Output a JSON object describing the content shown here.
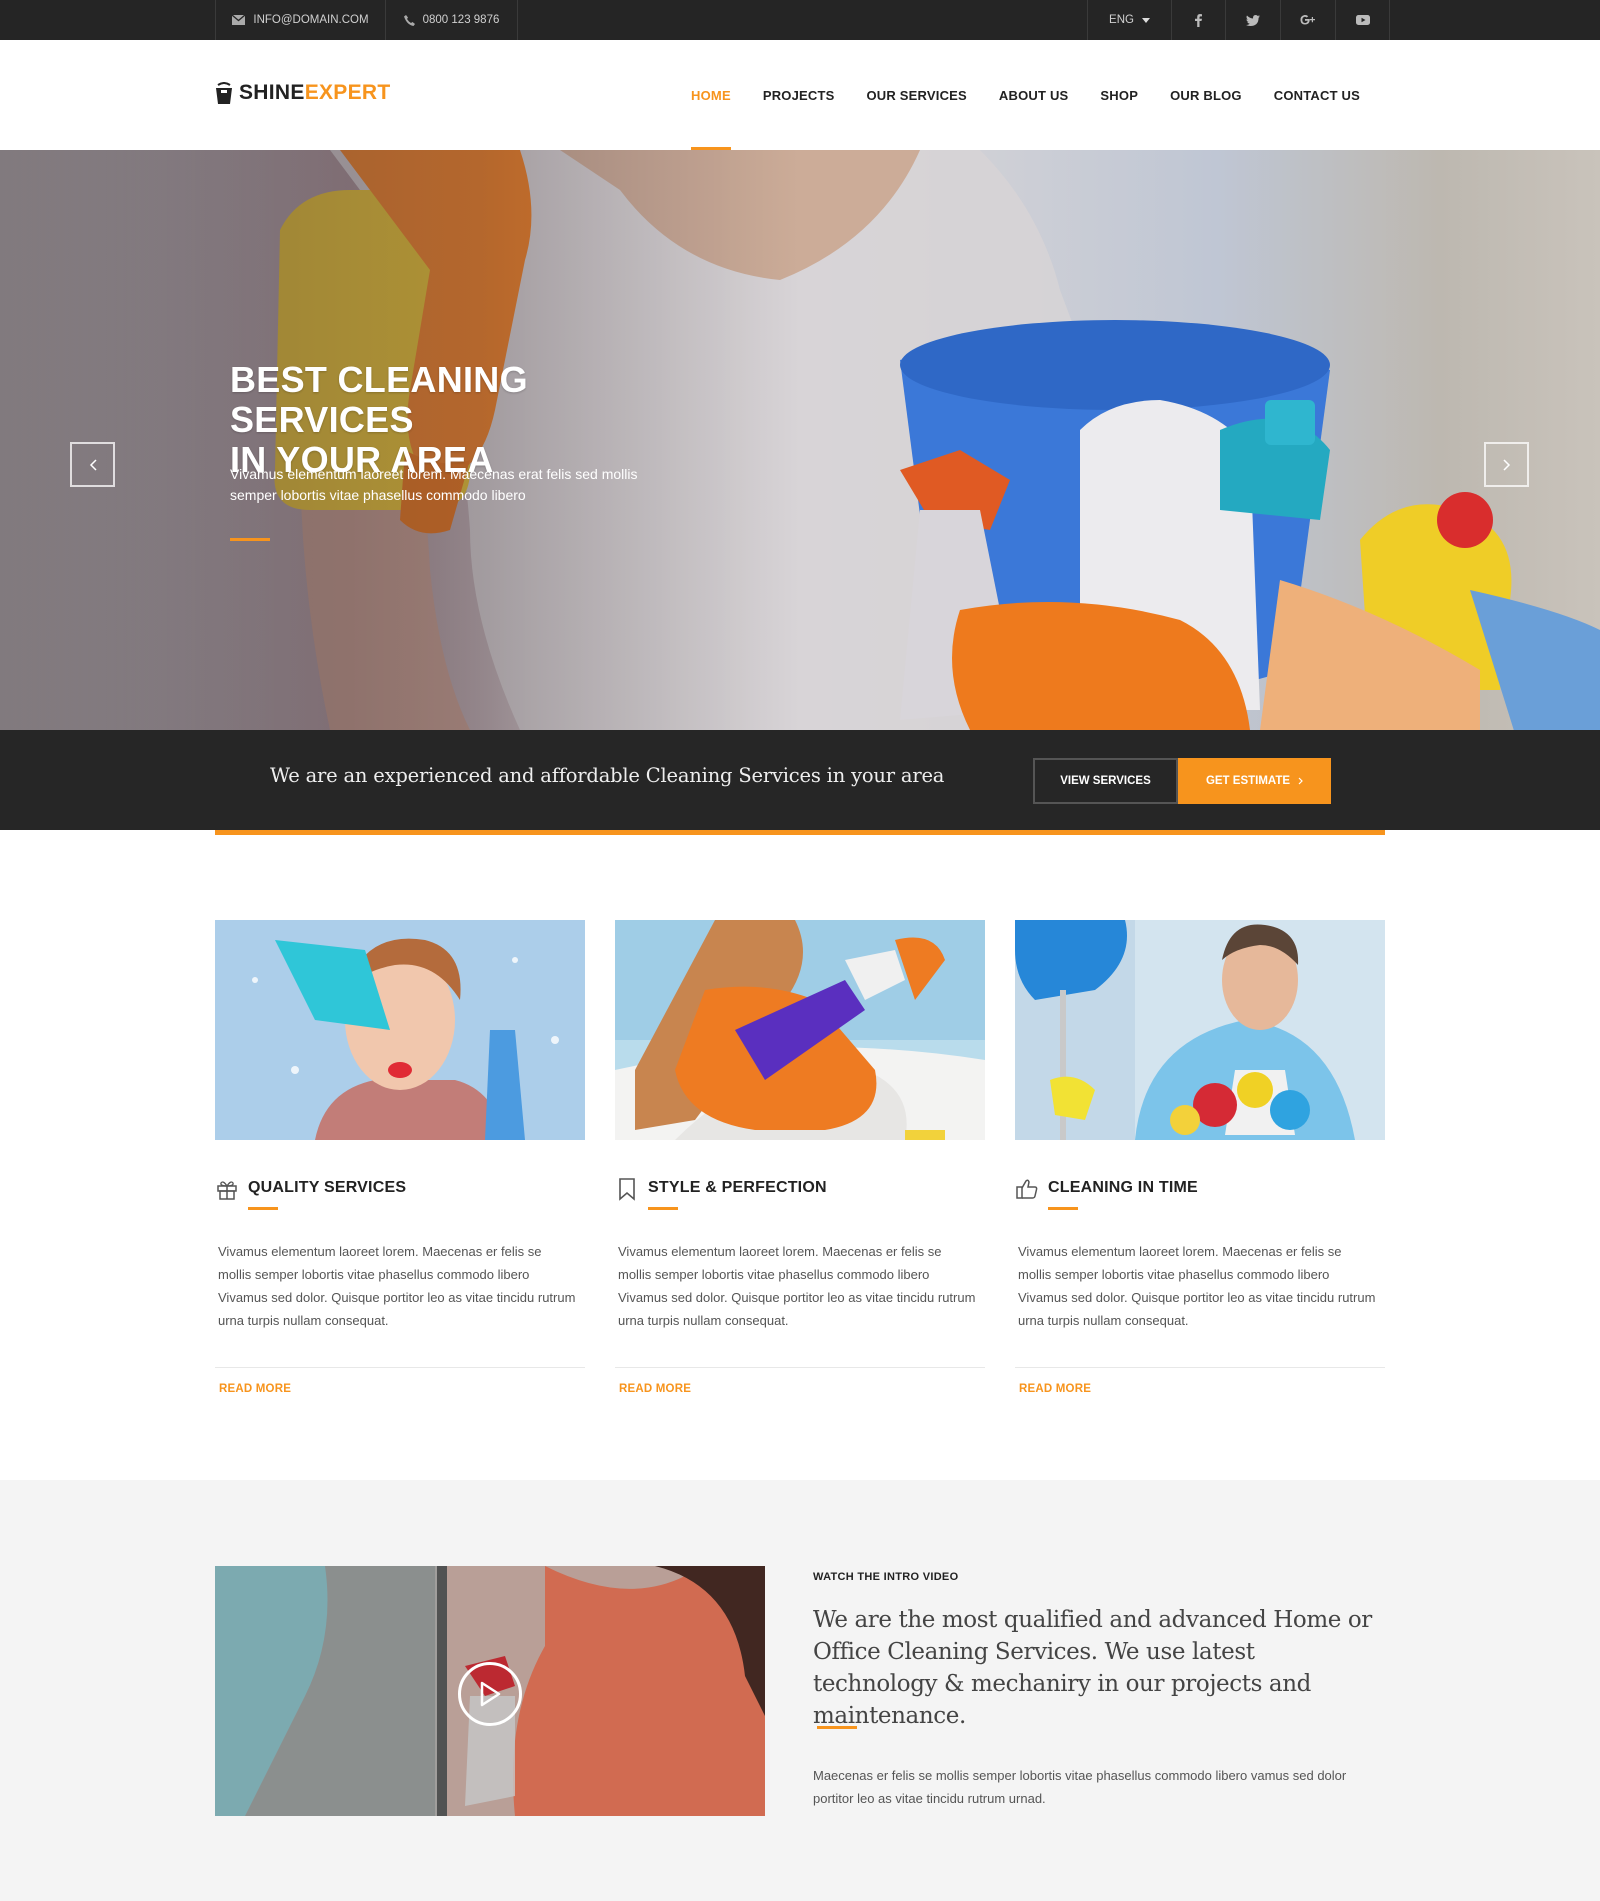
{
  "topbar": {
    "email": "INFO@DOMAIN.COM",
    "phone": "0800 123 9876",
    "language": "ENG",
    "icons": [
      "envelope-icon",
      "phone-icon",
      "caret-down-icon",
      "facebook-icon",
      "twitter-icon",
      "google-plus-icon",
      "youtube-icon"
    ]
  },
  "brand": {
    "part1": "SHINE",
    "part2": "EXPERT",
    "icon": "bucket-icon"
  },
  "nav": {
    "items": [
      {
        "label": "HOME",
        "active": true
      },
      {
        "label": "PROJECTS"
      },
      {
        "label": "OUR SERVICES"
      },
      {
        "label": "ABOUT US"
      },
      {
        "label": "SHOP"
      },
      {
        "label": "OUR BLOG"
      },
      {
        "label": "CONTACT US"
      }
    ]
  },
  "hero": {
    "title_line1": "BEST CLEANING SERVICES",
    "title_line2": "IN YOUR AREA",
    "text_line1": "Vivamus elementum laoreet lorem. Maecenas erat felis sed mollis",
    "text_line2": "semper lobortis vitae phasellus commodo libero"
  },
  "cta": {
    "text": "We are an experienced and affordable Cleaning Services in your area",
    "view_services": "VIEW SERVICES",
    "get_estimate": "GET ESTIMATE"
  },
  "services": [
    {
      "title": "QUALITY SERVICES",
      "icon": "gift-icon",
      "text": "Vivamus elementum laoreet lorem. Maecenas er felis se mollis semper lobortis vitae phasellus commodo libero Vivamus sed dolor. Quisque portitor leo as vitae tincidu rutrum urna turpis nullam consequat.",
      "more": "READ MORE"
    },
    {
      "title": "STYLE & PERFECTION",
      "icon": "bookmark-icon",
      "text": "Vivamus elementum laoreet lorem. Maecenas er felis se mollis semper lobortis vitae phasellus commodo libero Vivamus sed dolor. Quisque portitor leo as vitae tincidu rutrum urna turpis nullam consequat.",
      "more": "READ MORE"
    },
    {
      "title": "CLEANING IN TIME",
      "icon": "thumbs-up-icon",
      "text": "Vivamus elementum laoreet lorem. Maecenas er felis se mollis semper lobortis vitae phasellus commodo libero Vivamus sed dolor. Quisque portitor leo as vitae tincidu rutrum urna turpis nullam consequat.",
      "more": "READ MORE"
    }
  ],
  "video": {
    "label": "WATCH THE INTRO VIDEO",
    "heading": "We are the most qualified and advanced Home or Office Cleaning Services. We use latest technology & mechaniry in our projects and maintenance.",
    "text": "Maecenas er felis se mollis semper lobortis vitae phasellus commodo libero vamus sed dolor portitor leo as vitae tincidu rutrum urnad."
  },
  "colors": {
    "accent": "#f7941d",
    "dark": "#252525",
    "light_bg": "#f4f4f4"
  }
}
